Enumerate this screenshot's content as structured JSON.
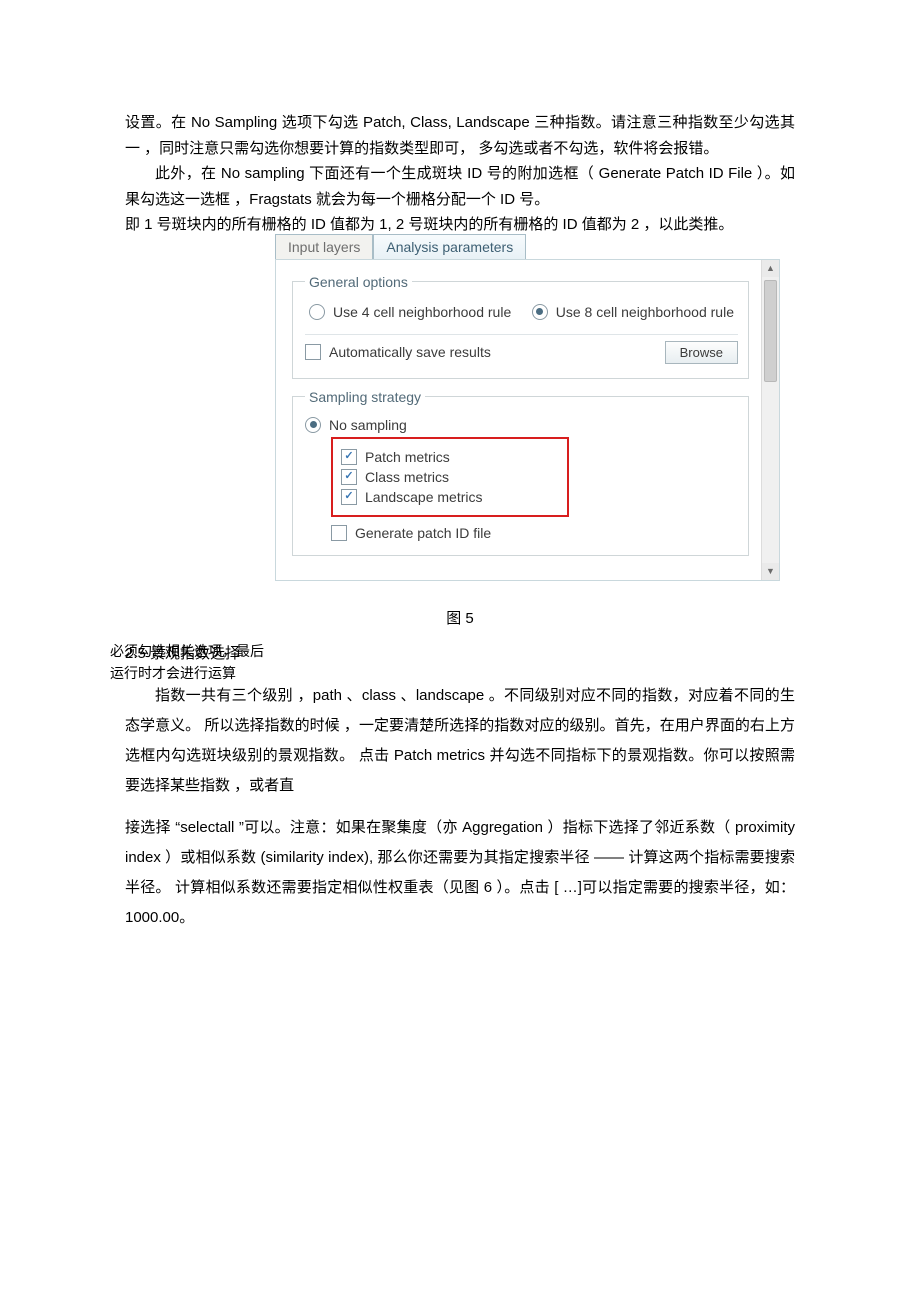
{
  "para1": "设置。在 No Sampling 选项下勾选 Patch, Class, Landscape 三种指数。请注意三种指数至少勾选其一 ，同时注意只需勾选你想要计算的指数类型即可， 多勾选或者不勾选，软件将会报错。",
  "para2": "此外，在 No sampling 下面还有一个生成斑块 ID 号的附加选框（ Generate Patch ID File ）。如果勾选这一选框 ，Fragstats 就会为每一个栅格分配一个 ID 号。",
  "para3": "即 1 号斑块内的所有栅格的 ID 值都为 1, 2 号斑块内的所有栅格的 ID 值都为 2 ，以此类推。",
  "annotation": {
    "line1": "必须勾选相关选项，最后",
    "line2": "运行时才会进行运算"
  },
  "figure": {
    "tabInput": "Input layers",
    "tabAnalysis": "Analysis parameters",
    "legendGeneral": "General options",
    "opt4cell": "Use 4 cell neighborhood rule",
    "opt8cell": "Use 8 cell neighborhood rule",
    "autosave": "Automatically save results",
    "browse": "Browse",
    "legendSampling": "Sampling strategy",
    "noSampling": "No sampling",
    "patchMetrics": "Patch metrics",
    "classMetrics": "Class metrics",
    "landscapeMetrics": "Landscape metrics",
    "genPatchId": "Generate patch ID file"
  },
  "figCaption": "图 5",
  "sectionHeading": "2.5  景观指数选择",
  "para4": "指数一共有三个级别 ，path 、class 、landscape 。不同级别对应不同的指数，对应着不同的生态学意义。 所以选择指数的时候 ，一定要清楚所选择的指数对应的级别。首先，在用户界面的右上方选框内勾选斑块级别的景观指数。 点击 Patch metrics 并勾选不同指标下的景观指数。你可以按照需要选择某些指数 ，或者直",
  "para5": "接选择 “selectall ”可以。注意：如果在聚集度（亦 Aggregation ）指标下选择了邻近系数（ proximity index  ）或相似系数 (similarity index), 那么你还需要为其指定搜索半径 —— 计算这两个指标需要搜索半径。 计算相似系数还需要指定相似性权重表（见图 6 ）。点击 [ …]可以指定需要的搜索半径，如： 1000.00。"
}
